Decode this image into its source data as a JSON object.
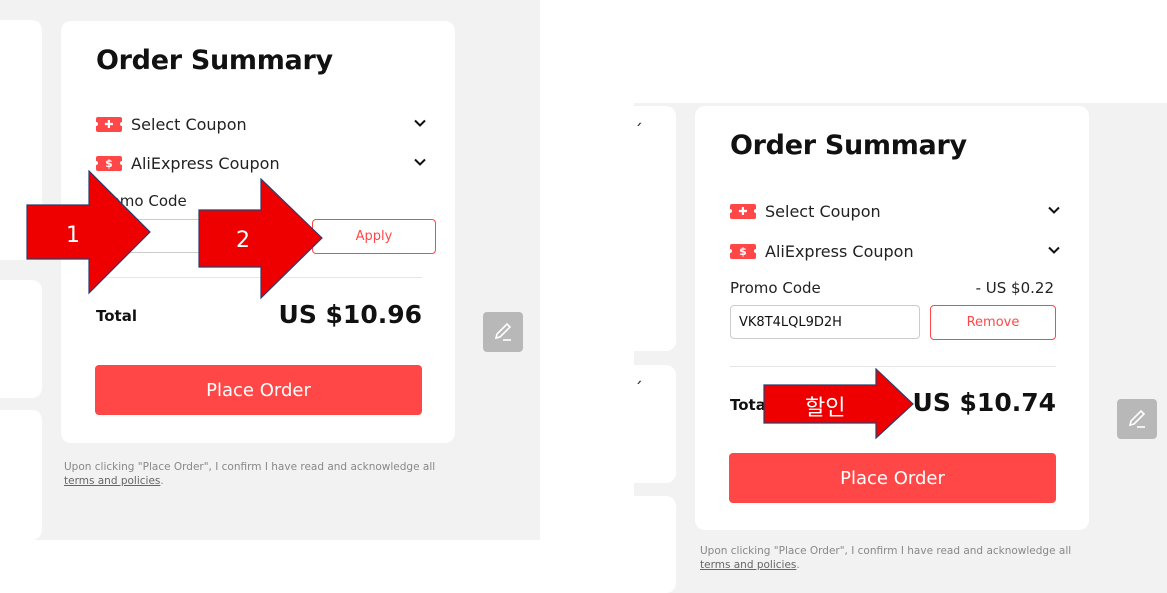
{
  "left_screenshot": {
    "title": "Order Summary",
    "select_coupon": "Select Coupon",
    "aliexpress_coupon": "AliExpress Coupon",
    "promo_code_label": "Promo Code",
    "promo_input_value": "",
    "apply_button": "Apply",
    "total_label": "Total",
    "total_amount": "US $10.96",
    "place_order": "Place Order",
    "disclaimer": "Upon clicking \"Place Order\", I confirm I have read and acknowledge all",
    "terms_link": "terms and policies",
    "terms_suffix": "."
  },
  "right_screenshot": {
    "title": "Order Summary",
    "select_coupon": "Select Coupon",
    "aliexpress_coupon": "AliExpress Coupon",
    "promo_code_label": "Promo Code",
    "promo_discount": "- US $0.22",
    "promo_input_value": "VK8T4LQL9D2H",
    "remove_button": "Remove",
    "total_label": "Total",
    "total_amount": "US $10.74",
    "place_order": "Place Order",
    "disclaimer": "Upon clicking \"Place Order\", I confirm I have read and acknowledge all",
    "terms_link": "terms and policies",
    "terms_suffix": "."
  },
  "annotations": {
    "arrow1_label": "1",
    "arrow2_label": "2",
    "arrow3_label": "할인"
  },
  "icons": {
    "coupon_badge": "coupon-ticket-icon",
    "aliexpress_badge": "dollar-ticket-icon",
    "chevron": "chevron-down-icon",
    "edit": "pencil-icon"
  },
  "colors": {
    "accent": "#ff4747",
    "annotation_red": "#ee0000",
    "panel_bg": "#f2f2f2"
  }
}
